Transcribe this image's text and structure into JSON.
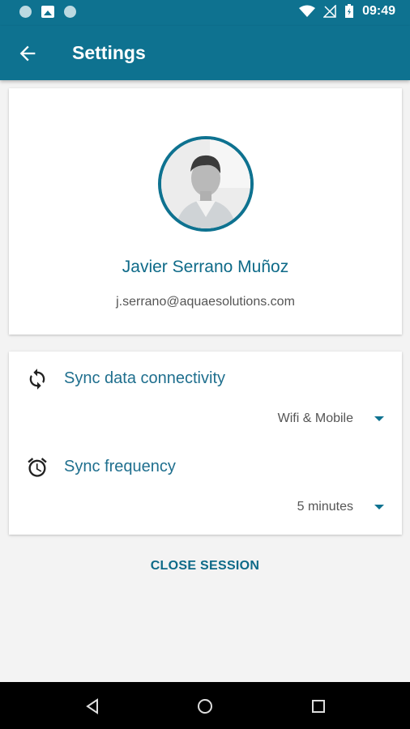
{
  "status_bar": {
    "time": "09:49"
  },
  "app_bar": {
    "title": "Settings"
  },
  "profile": {
    "name": "Javier Serrano Muñoz",
    "email": "j.serrano@aquaesolutions.com"
  },
  "sync": {
    "connectivity": {
      "label": "Sync data connectivity",
      "value": "Wifi & Mobile",
      "icon": "sync-icon"
    },
    "frequency": {
      "label": "Sync frequency",
      "value": "5 minutes",
      "icon": "alarm-clock-icon"
    }
  },
  "actions": {
    "close_session": "CLOSE SESSION"
  },
  "colors": {
    "primary": "#0e7290",
    "accent_text": "#1f6f8e",
    "background": "#f3f3f3"
  }
}
